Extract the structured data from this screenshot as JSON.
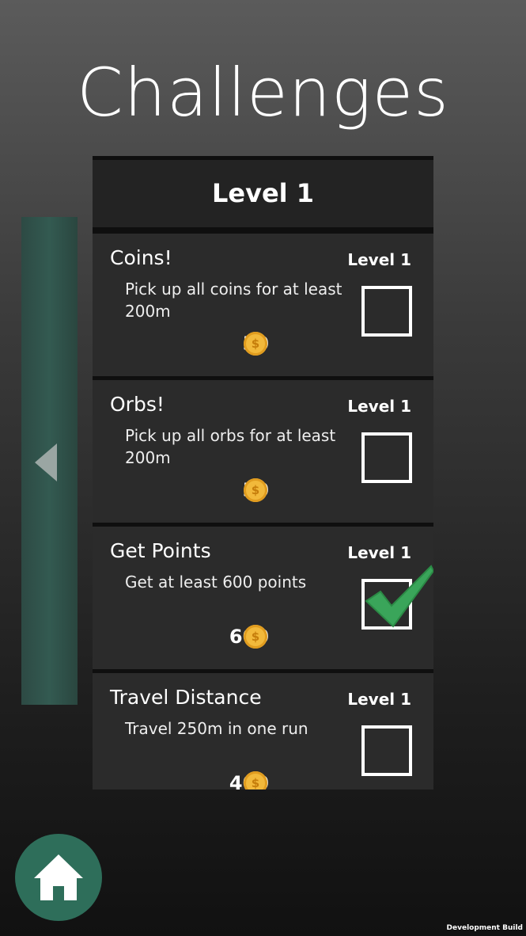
{
  "title": "Challenges",
  "level_header": "Level 1",
  "nav": {
    "prev_icon": "chevron-left-icon",
    "home_icon": "home-icon"
  },
  "challenges": [
    {
      "name": "Coins!",
      "level": "Level 1",
      "description": "Pick up all coins for at least 200m",
      "reward": "50",
      "completed": false
    },
    {
      "name": "Orbs!",
      "level": "Level 1",
      "description": "Pick up all orbs for at least 200m",
      "reward": "50",
      "completed": false
    },
    {
      "name": "Get Points",
      "level": "Level 1",
      "description": "Get at least 600 points",
      "reward": "600",
      "completed": true
    },
    {
      "name": "Travel Distance",
      "level": "Level 1",
      "description": "Travel 250m in one run",
      "reward": "400",
      "completed": false
    }
  ],
  "coin_symbol": "$",
  "footer": "Development Build",
  "colors": {
    "accent": "#2e6e5a",
    "check": "#3aa55a",
    "coin": "#f2b93b"
  }
}
